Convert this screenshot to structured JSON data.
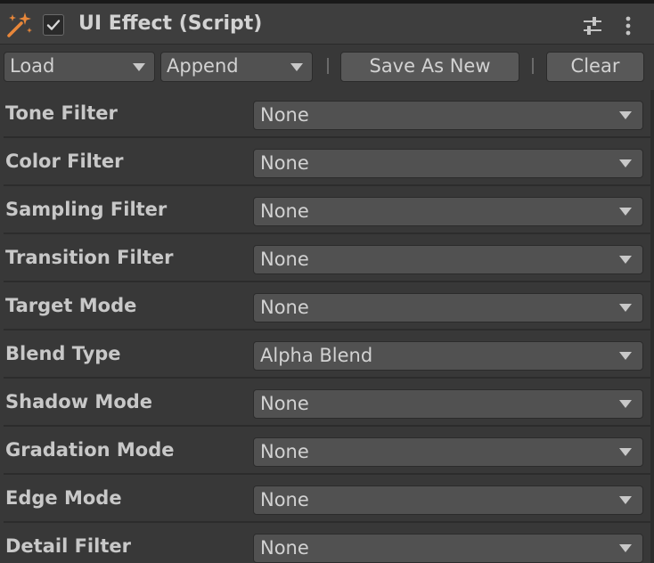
{
  "header": {
    "title": "UI Effect (Script)",
    "enabled": true,
    "accent_color": "#e8873a"
  },
  "toolbar": {
    "load_label": "Load",
    "append_label": "Append",
    "save_as_new_label": "Save As New",
    "clear_label": "Clear"
  },
  "properties": [
    {
      "label": "Tone Filter",
      "value": "None"
    },
    {
      "label": "Color Filter",
      "value": "None"
    },
    {
      "label": "Sampling Filter",
      "value": "None"
    },
    {
      "label": "Transition Filter",
      "value": "None"
    },
    {
      "label": "Target Mode",
      "value": "None"
    },
    {
      "label": "Blend Type",
      "value": "Alpha Blend"
    },
    {
      "label": "Shadow Mode",
      "value": "None"
    },
    {
      "label": "Gradation Mode",
      "value": "None"
    },
    {
      "label": "Edge Mode",
      "value": "None"
    },
    {
      "label": "Detail Filter",
      "value": "None"
    }
  ],
  "icons": {
    "component": "magic-wand-icon",
    "enable_toggle": "checkmark-icon",
    "presets": "sliders-icon",
    "context_menu": "vertical-dots-icon",
    "dropdown": "triangle-down-icon"
  },
  "colors": {
    "background": "#383838",
    "field": "#515151",
    "button": "#585858",
    "text": "#d2d2d2"
  }
}
